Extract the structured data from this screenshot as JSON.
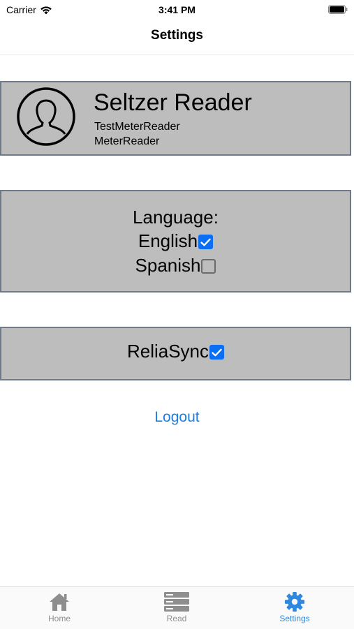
{
  "status_bar": {
    "carrier": "Carrier",
    "time": "3:41 PM",
    "icons": [
      "wifi-icon",
      "battery-icon"
    ]
  },
  "nav": {
    "title": "Settings"
  },
  "profile": {
    "name": "Seltzer Reader",
    "username": "TestMeterReader",
    "role": "MeterReader",
    "avatar_icon": "person-silhouette-icon"
  },
  "language": {
    "heading": "Language:",
    "options": [
      {
        "label": "English",
        "checked": true
      },
      {
        "label": "Spanish",
        "checked": false
      }
    ]
  },
  "sync": {
    "label": "ReliaSync",
    "checked": true
  },
  "logout_label": "Logout",
  "tabs": [
    {
      "label": "Home",
      "icon": "house-icon",
      "active": false
    },
    {
      "label": "Read",
      "icon": "server-rack-icon",
      "active": false
    },
    {
      "label": "Settings",
      "icon": "gear-icon",
      "active": true
    }
  ],
  "colors": {
    "card_bg": "#bdbdbd",
    "card_border": "#6e7a88",
    "accent": "#1e7fe0",
    "checkbox_checked": "#0a6ff5"
  }
}
